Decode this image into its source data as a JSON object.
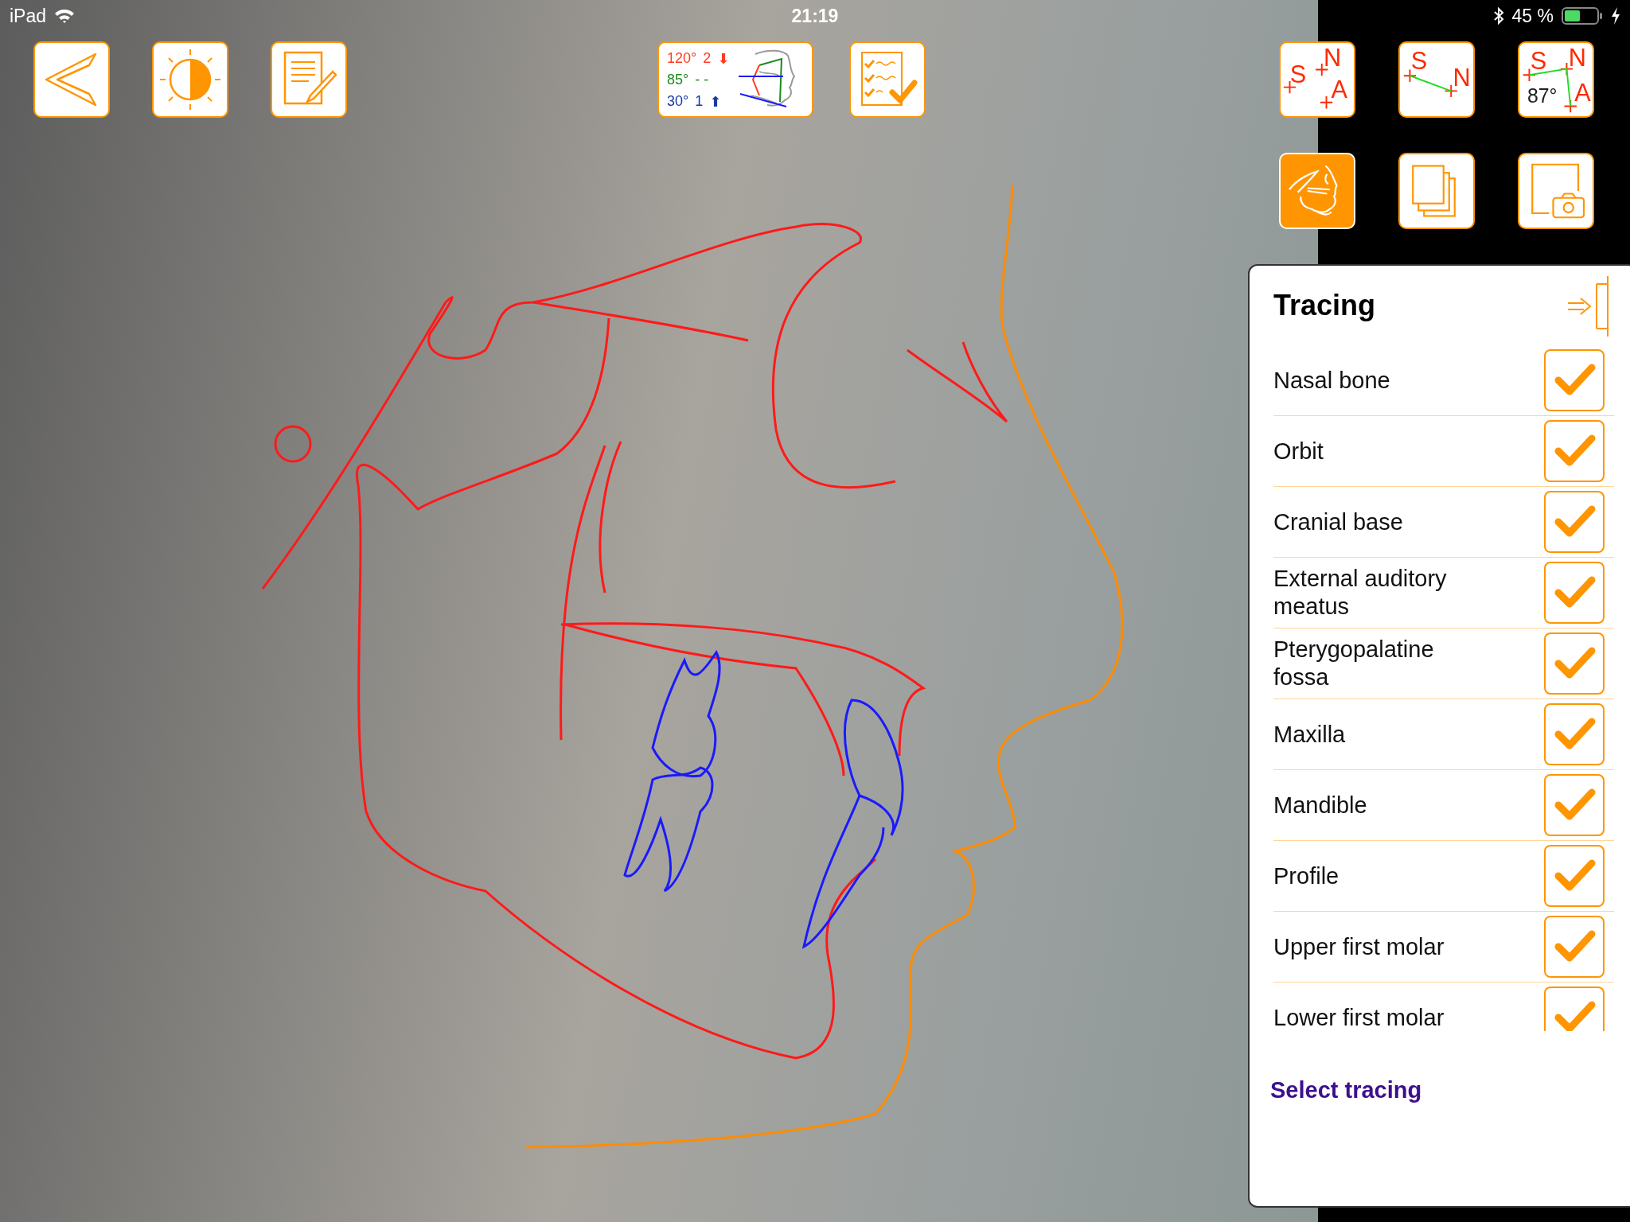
{
  "status_bar": {
    "device": "iPad",
    "time": "21:19",
    "battery_percent": "45 %"
  },
  "measurements": [
    {
      "angle": "120°",
      "value": "2",
      "arrow": "⬇",
      "color": "#ff3b1f"
    },
    {
      "angle": "85°",
      "value": "- -",
      "color": "#1f8a1f"
    },
    {
      "angle": "30°",
      "value": "1",
      "arrow": "⬆",
      "color": "#1a3aa0"
    }
  ],
  "analysis_buttons": [
    {
      "letters": [
        "S",
        "N",
        "A"
      ]
    },
    {
      "letters": [
        "S",
        "N"
      ]
    },
    {
      "letters": [
        "S",
        "N",
        "A"
      ],
      "angle": "87°"
    }
  ],
  "view_buttons": [
    {
      "kind": "tracing",
      "selected": true
    },
    {
      "kind": "layers",
      "selected": false
    },
    {
      "kind": "snapshot",
      "selected": false
    }
  ],
  "panel": {
    "title": "Tracing",
    "items": [
      {
        "label": "Nasal bone",
        "checked": true
      },
      {
        "label": "Orbit",
        "checked": true
      },
      {
        "label": "Cranial base",
        "checked": true
      },
      {
        "label": "External auditory meatus",
        "checked": true
      },
      {
        "label": "Pterygopalatine fossa",
        "checked": true
      },
      {
        "label": "Maxilla",
        "checked": true
      },
      {
        "label": "Mandible",
        "checked": true
      },
      {
        "label": "Profile",
        "checked": true
      },
      {
        "label": "Upper first molar",
        "checked": true
      },
      {
        "label": "Lower first molar",
        "checked": true
      }
    ],
    "link": "Select tracing"
  }
}
